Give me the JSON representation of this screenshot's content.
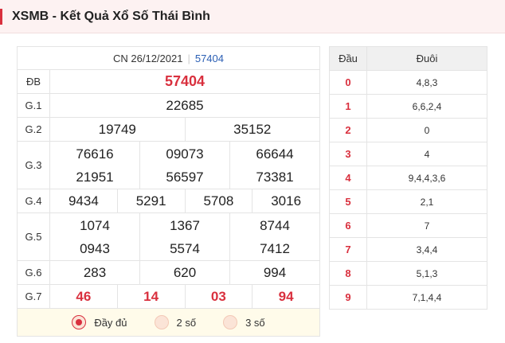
{
  "header": {
    "title": "XSMB - Kết Quả Xổ Số Thái Bình"
  },
  "results": {
    "date": "CN 26/12/2021",
    "code": "57404",
    "prizes": {
      "db": {
        "label": "ĐB",
        "values": [
          "57404"
        ]
      },
      "g1": {
        "label": "G.1",
        "values": [
          "22685"
        ]
      },
      "g2": {
        "label": "G.2",
        "values": [
          "19749",
          "35152"
        ]
      },
      "g3": {
        "label": "G.3",
        "values": [
          "76616",
          "09073",
          "66644",
          "21951",
          "56597",
          "73381"
        ]
      },
      "g4": {
        "label": "G.4",
        "values": [
          "9434",
          "5291",
          "5708",
          "3016"
        ]
      },
      "g5": {
        "label": "G.5",
        "values": [
          "1074",
          "1367",
          "8744",
          "0943",
          "5574",
          "7412"
        ]
      },
      "g6": {
        "label": "G.6",
        "values": [
          "283",
          "620",
          "994"
        ]
      },
      "g7": {
        "label": "G.7",
        "values": [
          "46",
          "14",
          "03",
          "94"
        ]
      }
    }
  },
  "options": [
    {
      "label": "Đầy đủ",
      "selected": true
    },
    {
      "label": "2 số",
      "selected": false
    },
    {
      "label": "3 số",
      "selected": false
    }
  ],
  "loto": {
    "headers": [
      "Đầu",
      "Đuôi"
    ],
    "rows": [
      {
        "dau": "0",
        "duoi": "4,8,3"
      },
      {
        "dau": "1",
        "duoi": "6,6,2,4"
      },
      {
        "dau": "2",
        "duoi": "0"
      },
      {
        "dau": "3",
        "duoi": "4"
      },
      {
        "dau": "4",
        "duoi": "9,4,4,3,6"
      },
      {
        "dau": "5",
        "duoi": "2,1"
      },
      {
        "dau": "6",
        "duoi": "7"
      },
      {
        "dau": "7",
        "duoi": "3,4,4"
      },
      {
        "dau": "8",
        "duoi": "5,1,3"
      },
      {
        "dau": "9",
        "duoi": "7,1,4,4"
      }
    ]
  },
  "colors": {
    "accent": "#d9303e",
    "link": "#2b5fb4",
    "header_bg": "#fdf2f2",
    "options_bg": "#fffbea"
  }
}
